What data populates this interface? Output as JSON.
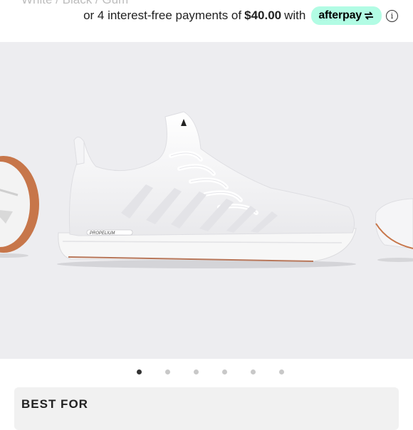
{
  "product": {
    "subtitle_cut": "White / Black / Gum"
  },
  "afterpay": {
    "prefix": "or 4 interest-free payments of",
    "amount": "$40.00",
    "suffix": "with",
    "brand": "afterpay",
    "info_symbol": "i",
    "brand_color": "#b2fce4"
  },
  "gallery": {
    "background": "#ededf0",
    "slide_count": 6,
    "active_index": 0
  },
  "sections": {
    "best_for_label": "BEST FOR"
  }
}
